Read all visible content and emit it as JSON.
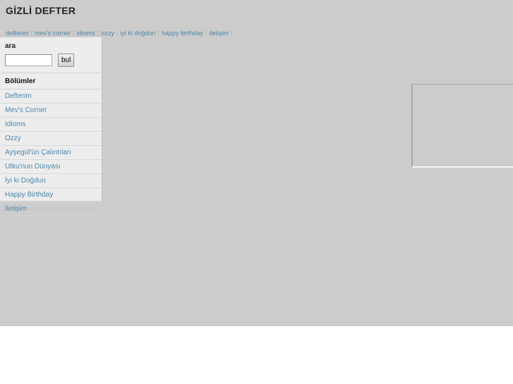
{
  "header": {
    "site_title": "GİZLİ DEFTER"
  },
  "topnav": {
    "separator": "/",
    "trailing_separator": "/",
    "items": [
      {
        "label": "defterim"
      },
      {
        "label": "mev's corner"
      },
      {
        "label": "idioms"
      },
      {
        "label": "ozzy"
      },
      {
        "label": "iyi ki doğdun"
      },
      {
        "label": "happy birthday"
      },
      {
        "label": "iletişim"
      }
    ]
  },
  "sidebar": {
    "search": {
      "label": "ara",
      "input_value": "",
      "input_placeholder": "",
      "button_label": "bul"
    },
    "sections_title": "Bölümler",
    "sections": [
      {
        "label": "Defterim"
      },
      {
        "label": "Mev's Corner"
      },
      {
        "label": "Idioms"
      },
      {
        "label": "Ozzy"
      },
      {
        "label": "Ayşegül'ün Çalıntıları"
      },
      {
        "label": "Utku'nun Dünyası"
      },
      {
        "label": "İyi ki Doğdun"
      },
      {
        "label": "Happy Birthday"
      },
      {
        "label": "İletişim"
      }
    ]
  },
  "main": {
    "content_text": "",
    "media_placeholder_alt": ""
  },
  "colors": {
    "page_background": "#cccccc",
    "sidebar_background": "#ededed",
    "link": "#4a87ad",
    "title": "#222222",
    "divider": "#d9d9d9",
    "placeholder_border": "#a8a8a8"
  }
}
